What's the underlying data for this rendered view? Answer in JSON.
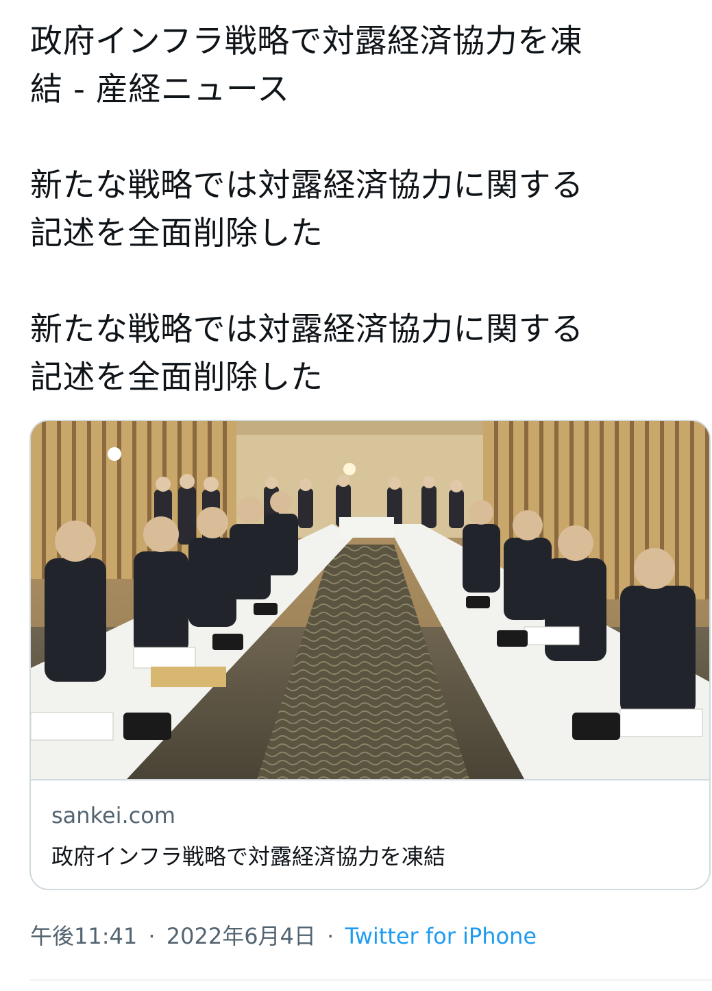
{
  "tweet": {
    "paragraphs": [
      "政府インフラ戦略で対露経済協力を凍\n結 - 産経ニュース",
      "新たな戦略では対露経済協力に関する\n記述を全面削除した",
      "新たな戦略では対露経済協力に関する\n記述を全面削除した"
    ]
  },
  "card": {
    "image_icon": "meeting-photo",
    "domain": "sankei.com",
    "title": "政府インフラ戦略で対露経済協力を凍結"
  },
  "meta": {
    "time": "午後11:41",
    "separator": "·",
    "date": "2022年6月4日",
    "source": "Twitter for iPhone"
  },
  "colors": {
    "text": "#0f1419",
    "secondary": "#536471",
    "border": "#cfd9de",
    "link": "#1d9bf0"
  }
}
